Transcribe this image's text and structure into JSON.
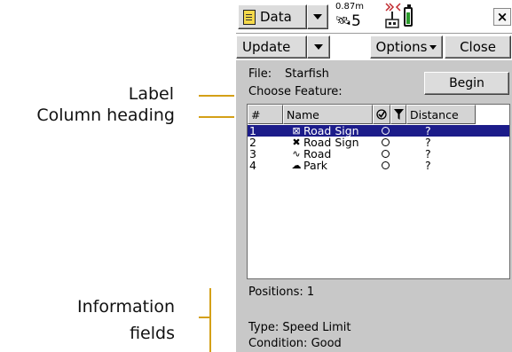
{
  "annotations": {
    "label": "Label",
    "column_heading": "Column heading",
    "information_line1": "Information",
    "information_line2": "fields",
    "line_color": "#d4a017"
  },
  "titlebar": {
    "menu_title": "Data",
    "gps_precision": "0.87m",
    "satellite_count": "5",
    "close_symbol": "×"
  },
  "toolbar": {
    "update_label": "Update",
    "options_label": "Options",
    "close_label": "Close"
  },
  "form": {
    "file_label": "File:",
    "file_name": "Starfish",
    "choose_feature_label": "Choose Feature:",
    "begin_label": "Begin"
  },
  "list": {
    "columns": [
      "#",
      "Name",
      "",
      "",
      "Distance"
    ],
    "rows": [
      {
        "num": "1",
        "icon": "road-sign-icon",
        "glyph": "⊠",
        "name": "Road Sign",
        "distance": "?",
        "selected": true
      },
      {
        "num": "2",
        "icon": "road-sign-point-icon",
        "glyph": "✖",
        "name": "Road Sign",
        "distance": "?",
        "selected": false
      },
      {
        "num": "3",
        "icon": "line-feature-icon",
        "glyph": "∿",
        "name": "Road",
        "distance": "?",
        "selected": false
      },
      {
        "num": "4",
        "icon": "area-feature-icon",
        "glyph": "☁",
        "name": "Park",
        "distance": "?",
        "selected": false
      }
    ],
    "selection_color": "#1c1c8a"
  },
  "info": {
    "positions_label": "Positions:",
    "positions_value": "1",
    "type_label": "Type:",
    "type_value": "Speed Limit",
    "condition_label": "Condition:",
    "condition_value": "Good"
  }
}
